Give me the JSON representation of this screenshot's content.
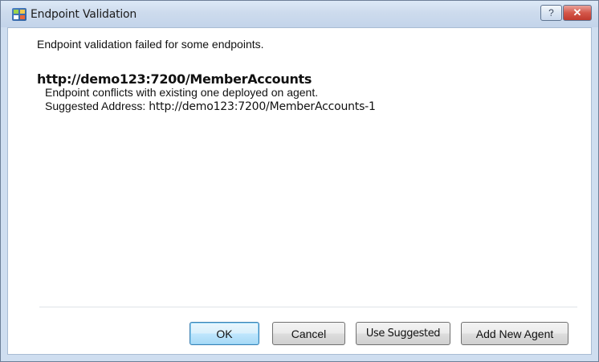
{
  "window": {
    "title": "Endpoint Validation",
    "help_glyph": "?",
    "close_glyph": "✕",
    "icon": "application-icon"
  },
  "body": {
    "message": "Endpoint validation failed for some endpoints.",
    "endpoint_url": "http://demo123:7200/MemberAccounts",
    "conflict_text": "Endpoint conflicts with existing one deployed on agent.",
    "suggested_label": "Suggested Address:",
    "suggested_address": "http://demo123:7200/MemberAccounts-1"
  },
  "buttons": {
    "ok": "OK",
    "cancel": "Cancel",
    "use_suggested": "Use Suggested",
    "add_new_agent": "Add New Agent"
  },
  "colors": {
    "title_bar": "#cddbed",
    "close_button": "#c13a2e",
    "default_button_border": "#3c7fb1"
  }
}
